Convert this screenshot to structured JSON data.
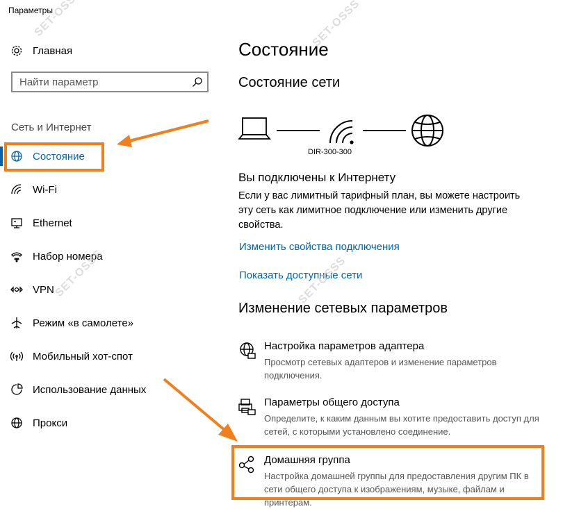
{
  "window": {
    "title": "Параметры"
  },
  "sidebar": {
    "home_label": "Главная",
    "search_placeholder": "Найти параметр",
    "section_title": "Сеть и Интернет",
    "items": [
      {
        "label": "Состояние",
        "icon": "globe-icon",
        "active": true
      },
      {
        "label": "Wi-Fi",
        "icon": "wifi-icon"
      },
      {
        "label": "Ethernet",
        "icon": "ethernet-icon"
      },
      {
        "label": "Набор номера",
        "icon": "dialup-icon"
      },
      {
        "label": "VPN",
        "icon": "vpn-icon"
      },
      {
        "label": "Режим «в самолете»",
        "icon": "airplane-icon"
      },
      {
        "label": "Мобильный хот-спот",
        "icon": "hotspot-icon"
      },
      {
        "label": "Использование данных",
        "icon": "data-usage-icon"
      },
      {
        "label": "Прокси",
        "icon": "proxy-globe-icon"
      }
    ]
  },
  "main": {
    "page_title": "Состояние",
    "network_status_title": "Состояние сети",
    "router_name": "DIR-300-300",
    "connected_heading": "Вы подключены к Интернету",
    "connected_text": "Если у вас лимитный тарифный план, вы можете настроить эту сеть как лимитное подключение или изменить другие свойства.",
    "link_change_props": "Изменить свойства подключения",
    "link_show_networks": "Показать доступные сети",
    "change_settings_title": "Изменение сетевых параметров",
    "settings": [
      {
        "title": "Настройка параметров адаптера",
        "desc": "Просмотр сетевых адаптеров и изменение параметров подключения.",
        "icon": "adapter-globe-icon"
      },
      {
        "title": "Параметры общего доступа",
        "desc": "Определите, к каким данным вы хотите предоставить доступ для сетей, с которыми установлено соединение.",
        "icon": "sharing-printer-icon"
      },
      {
        "title": "Домашняя группа",
        "desc": "Настройка домашней группы для предоставления другим ПК в сети общего доступа к изображениям, музыке, файлам и принтерам.",
        "icon": "homegroup-icon"
      }
    ]
  },
  "watermark": "SET-OSSS",
  "colors": {
    "accent": "#0063b1",
    "highlight": "#f07f1e"
  }
}
